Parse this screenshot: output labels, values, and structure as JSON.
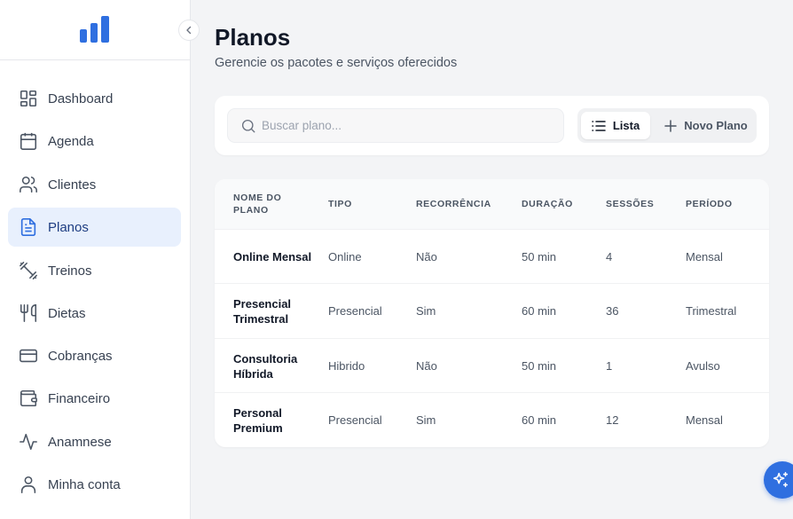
{
  "sidebar": {
    "items": [
      {
        "label": "Dashboard",
        "icon": "dashboard-icon"
      },
      {
        "label": "Agenda",
        "icon": "calendar-icon"
      },
      {
        "label": "Clientes",
        "icon": "users-icon"
      },
      {
        "label": "Planos",
        "icon": "document-icon",
        "active": true
      },
      {
        "label": "Treinos",
        "icon": "dumbbell-icon"
      },
      {
        "label": "Dietas",
        "icon": "utensils-icon"
      },
      {
        "label": "Cobranças",
        "icon": "credit-card-icon"
      },
      {
        "label": "Financeiro",
        "icon": "wallet-icon"
      },
      {
        "label": "Anamnese",
        "icon": "activity-icon"
      },
      {
        "label": "Minha conta",
        "icon": "user-icon"
      }
    ]
  },
  "page": {
    "title": "Planos",
    "subtitle": "Gerencie os pacotes e serviços oferecidos"
  },
  "toolbar": {
    "search_placeholder": "Buscar plano...",
    "list_label": "Lista",
    "new_label": "Novo Plano"
  },
  "table": {
    "headers": [
      "NOME DO PLANO",
      "TIPO",
      "RECORRÊNCIA",
      "DURAÇÃO",
      "SESSÕES",
      "PERÍODO"
    ],
    "rows": [
      {
        "name": "Online Mensal",
        "type": "Online",
        "recurrence": "Não",
        "duration": "50 min",
        "sessions": "4",
        "period": "Mensal"
      },
      {
        "name": "Presencial Trimestral",
        "type": "Presencial",
        "recurrence": "Sim",
        "duration": "60 min",
        "sessions": "36",
        "period": "Trimestral"
      },
      {
        "name": "Consultoria Híbrida",
        "type": "Hibrido",
        "recurrence": "Não",
        "duration": "50 min",
        "sessions": "1",
        "period": "Avulso"
      },
      {
        "name": "Personal Premium",
        "type": "Presencial",
        "recurrence": "Sim",
        "duration": "60 min",
        "sessions": "12",
        "period": "Mensal"
      }
    ]
  },
  "colors": {
    "accent": "#2f6fe0",
    "active_bg": "#e8f0fd",
    "active_text": "#1f3e82"
  },
  "fab": {
    "icon": "sparkles-icon"
  }
}
